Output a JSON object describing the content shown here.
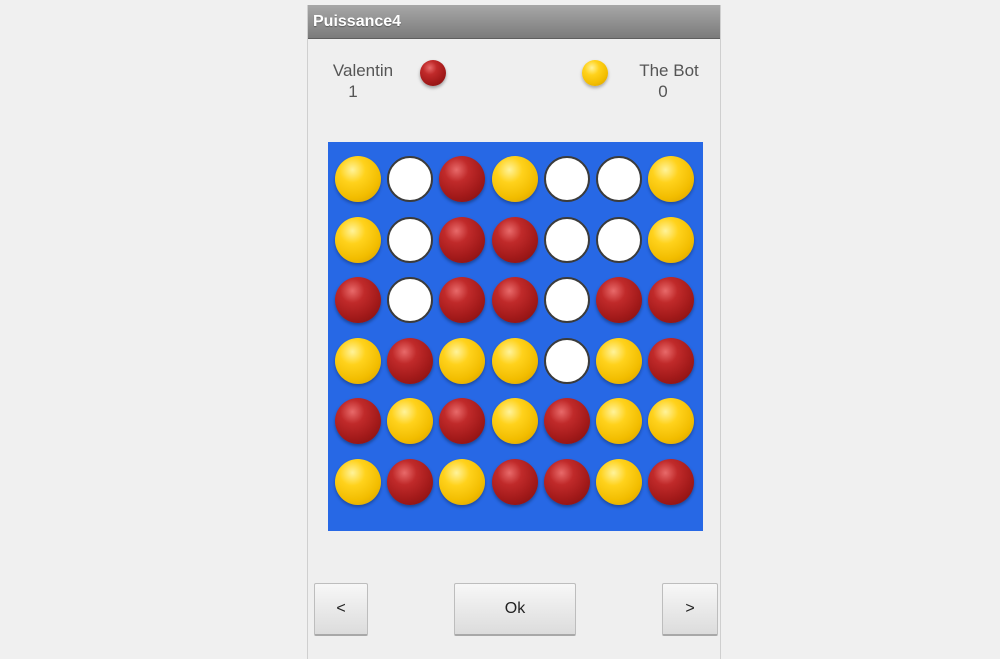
{
  "app": {
    "title": "Puissance4"
  },
  "players": [
    {
      "name": "Valentin",
      "score": "1",
      "color": "red"
    },
    {
      "name": "The Bot",
      "score": "0",
      "color": "yellow"
    }
  ],
  "colors": {
    "board": "#2768e5",
    "red": "#a31a1a",
    "yellow": "#f2bd00",
    "empty": "#ffffff",
    "titlebar": "#8a8a8a"
  },
  "board": [
    [
      "yellow",
      "empty",
      "red",
      "yellow",
      "empty",
      "empty",
      "yellow"
    ],
    [
      "yellow",
      "empty",
      "red",
      "red",
      "empty",
      "empty",
      "yellow"
    ],
    [
      "red",
      "empty",
      "red",
      "red",
      "empty",
      "red",
      "red"
    ],
    [
      "yellow",
      "red",
      "yellow",
      "yellow",
      "empty",
      "yellow",
      "red"
    ],
    [
      "red",
      "yellow",
      "red",
      "yellow",
      "red",
      "yellow",
      "yellow"
    ],
    [
      "yellow",
      "red",
      "yellow",
      "red",
      "red",
      "yellow",
      "red"
    ]
  ],
  "buttons": {
    "prev": "<",
    "ok": "Ok",
    "next": ">"
  }
}
